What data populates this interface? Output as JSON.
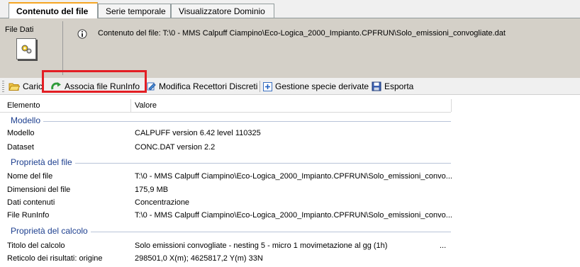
{
  "tabs": [
    {
      "label": "Contenuto del file"
    },
    {
      "label": "Serie temporale"
    },
    {
      "label": "Visualizzatore Dominio"
    }
  ],
  "info": {
    "file_label": "File Dati",
    "message": "Contenuto del file:  T:\\0 - MMS Calpuff Ciampino\\Eco-Logica_2000_Impianto.CPFRUN\\Solo_emissioni_convogliate.dat"
  },
  "toolbar": {
    "carica_label": "Caric",
    "associa_label": "Associa file RunInfo",
    "modifica_label": "Modifica Recettori Discreti",
    "gestione_label": "Gestione specie derivate",
    "esporta_label": "Esporta"
  },
  "grid": {
    "col_element": "Elemento",
    "col_value": "Valore",
    "sections": [
      {
        "title": "Modello",
        "rows": [
          {
            "key": "Modello",
            "value": "CALPUFF version 6.42 level 110325"
          },
          {
            "key": "Dataset",
            "value": "CONC.DAT version 2.2"
          }
        ]
      },
      {
        "title": "Proprietà del file",
        "rows": [
          {
            "key": "Nome del file",
            "value": "T:\\0 - MMS Calpuff Ciampino\\Eco-Logica_2000_Impianto.CPFRUN\\Solo_emissioni_convo..."
          },
          {
            "key": "Dimensioni del file",
            "value": "175,9 MB"
          },
          {
            "key": "Dati contenuti",
            "value": "Concentrazione"
          },
          {
            "key": "File RunInfo",
            "value": "T:\\0 - MMS Calpuff Ciampino\\Eco-Logica_2000_Impianto.CPFRUN\\Solo_emissioni_convo..."
          }
        ]
      },
      {
        "title": "Proprietà del calcolo",
        "rows": [
          {
            "key": "Titolo del calcolo",
            "value": "Solo emissioni convogliate - nesting 5 - micro 1 movimetazione al gg (1h)",
            "more": "..."
          },
          {
            "key": "Reticolo dei risultati: origine",
            "value": "298501,0 X(m); 4625817,2 Y(m) 33N"
          }
        ]
      }
    ]
  },
  "colors": {
    "highlight": "#e31e24",
    "section_title": "#1d3f8f"
  }
}
